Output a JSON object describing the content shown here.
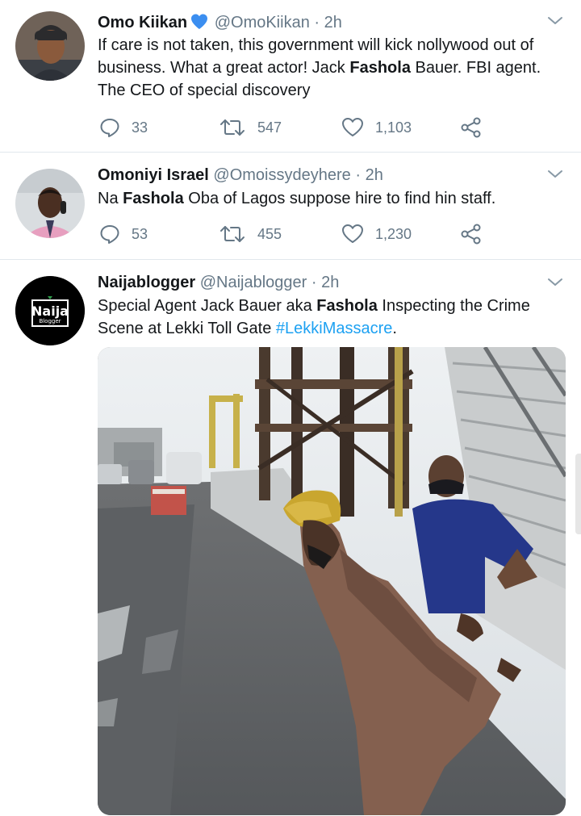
{
  "tweets": [
    {
      "name": "Omo Kiikan",
      "handle": "@OmoKiikan",
      "time": "2h",
      "text_parts": [
        "If care is not taken, this government will kick nollywood out of business. What a great actor! Jack ",
        "Fashola",
        " Bauer. FBI agent. The CEO of special discovery"
      ],
      "replies": "33",
      "retweets": "547",
      "likes": "1,103",
      "verified_icon": "blue-heart-emoji"
    },
    {
      "name": "Omoniyi Israel",
      "handle": "@Omoissydeyhere",
      "time": "2h",
      "text_parts": [
        "Na ",
        "Fashola",
        " Oba of Lagos suppose hire to find hin staff."
      ],
      "replies": "53",
      "retweets": "455",
      "likes": "1,230"
    },
    {
      "name": "Naijablogger",
      "handle": "@Naijablogger",
      "time": "2h",
      "text_parts": [
        "Special Agent Jack Bauer aka ",
        "Fashola",
        " Inspecting the Crime Scene at Lekki Toll Gate ",
        "#LekkiMassacre",
        "."
      ],
      "avatar_logo": {
        "line1": "Naija",
        "line2": "Blogger"
      }
    }
  ],
  "separator": "·",
  "colors": {
    "text": "#14171a",
    "secondary": "#657786",
    "link": "#1da1f2",
    "divider": "#e1e8ed",
    "heart": "#3b8ef0"
  }
}
